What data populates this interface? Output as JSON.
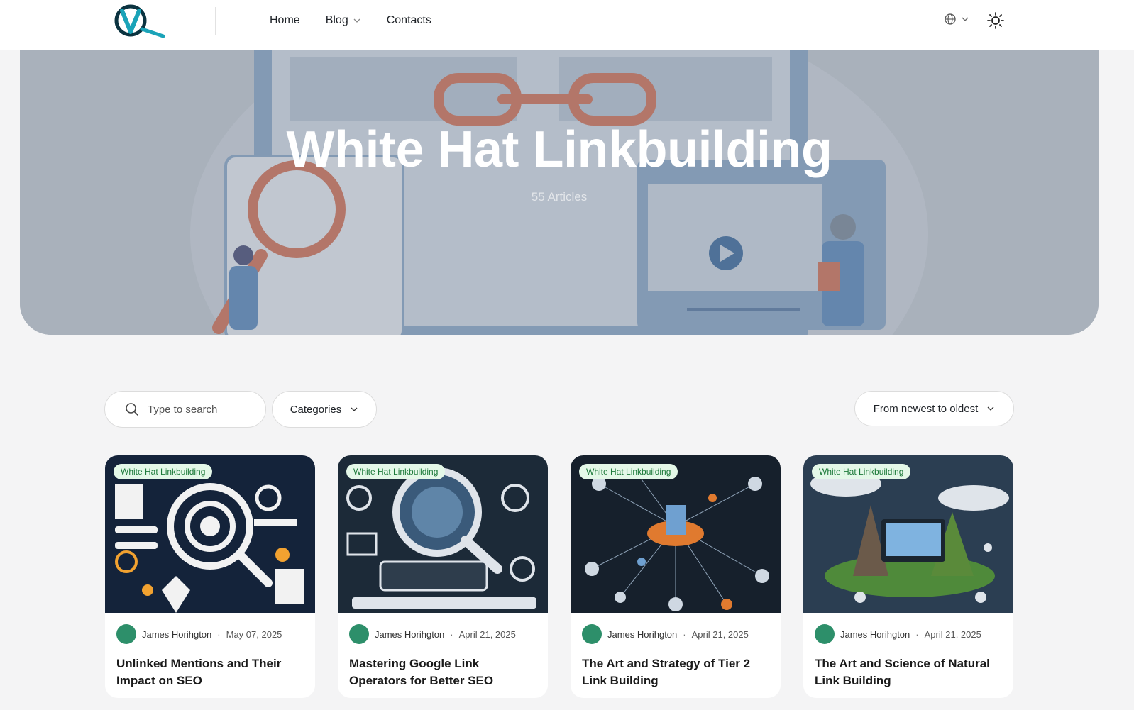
{
  "header": {
    "nav": [
      {
        "label": "Home"
      },
      {
        "label": "Blog",
        "has_dropdown": true
      },
      {
        "label": "Contacts"
      }
    ],
    "language_icon": "globe-icon",
    "theme_icon": "sun-icon"
  },
  "hero": {
    "title": "White Hat Linkbuilding",
    "subtitle": "55 Articles"
  },
  "filters": {
    "search_placeholder": "Type to search",
    "categories_label": "Categories",
    "sort_label": "From newest to oldest"
  },
  "cards": [
    {
      "badge": "White Hat Linkbuilding",
      "author": "James Horihgton",
      "date": "May 07, 2025",
      "title": "Unlinked Mentions and Their Impact on SEO"
    },
    {
      "badge": "White Hat Linkbuilding",
      "author": "James Horihgton",
      "date": "April 21, 2025",
      "title": "Mastering Google Link Operators for Better SEO"
    },
    {
      "badge": "White Hat Linkbuilding",
      "author": "James Horihgton",
      "date": "April 21, 2025",
      "title": "The Art and Strategy of Tier 2 Link Building"
    },
    {
      "badge": "White Hat Linkbuilding",
      "author": "James Horihgton",
      "date": "April 21, 2025",
      "title": "The Art and Science of Natural Link Building"
    }
  ],
  "colors": {
    "accent": "#2d8f6a",
    "badge_bg": "#e4f8e8",
    "badge_text": "#1d7a3a"
  }
}
